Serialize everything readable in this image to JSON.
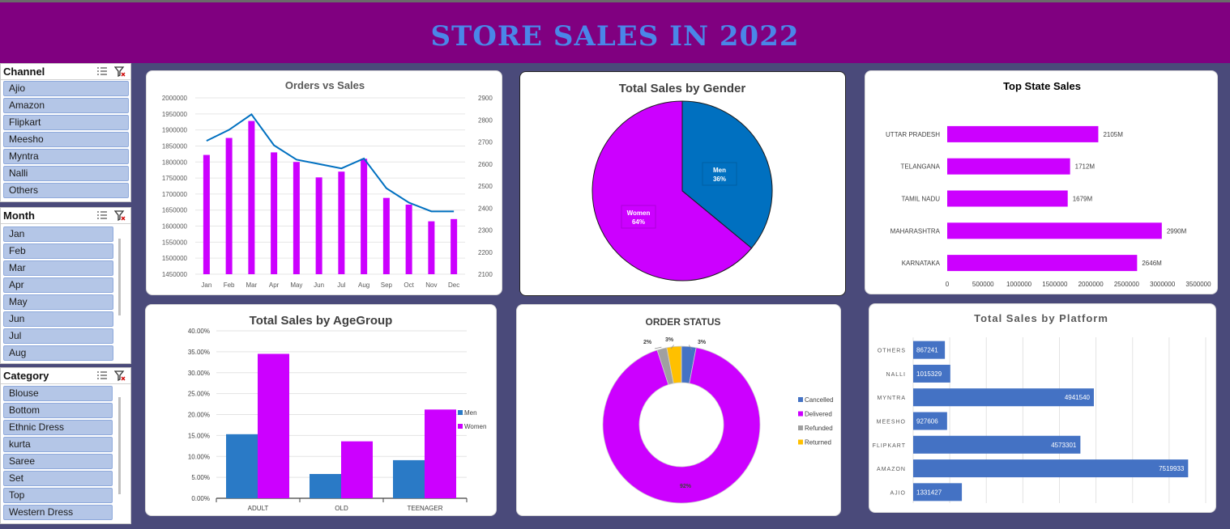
{
  "header": {
    "title": "STORE SALES IN 2022"
  },
  "slicers": {
    "channel": {
      "title": "Channel",
      "items": [
        "Ajio",
        "Amazon",
        "Flipkart",
        "Meesho",
        "Myntra",
        "Nalli",
        "Others"
      ]
    },
    "month": {
      "title": "Month",
      "items": [
        "Jan",
        "Feb",
        "Mar",
        "Apr",
        "May",
        "Jun",
        "Jul",
        "Aug"
      ]
    },
    "category": {
      "title": "Category",
      "items": [
        "Blouse",
        "Bottom",
        "Ethnic Dress",
        "kurta",
        "Saree",
        "Set",
        "Top",
        "Western Dress"
      ]
    }
  },
  "colors": {
    "magenta": "#cc00ff",
    "blue": "#0070c0",
    "bar_blue": "#4472c4",
    "gray": "#a0a0a0",
    "gold": "#ffc000",
    "banner": "#800080",
    "title_blue": "#4a86e8"
  },
  "chart_data": [
    {
      "id": "orders_vs_sales",
      "type": "bar",
      "title": "Orders vs Sales",
      "categories": [
        "Jan",
        "Feb",
        "Mar",
        "Apr",
        "May",
        "Jun",
        "Jul",
        "Aug",
        "Sep",
        "Oct",
        "Nov",
        "Dec"
      ],
      "series": [
        {
          "type": "bar",
          "axis": "left",
          "values": [
            1822000,
            1875000,
            1928000,
            1830000,
            1800000,
            1752000,
            1770000,
            1810000,
            1688000,
            1667000,
            1615000,
            1622000
          ]
        },
        {
          "type": "line",
          "axis": "right",
          "values": [
            2705,
            2755,
            2825,
            2685,
            2620,
            2600,
            2580,
            2625,
            2490,
            2425,
            2385,
            2385
          ]
        }
      ],
      "ylim_left": [
        1450000,
        2000000
      ],
      "yticks_left": [
        "2000000",
        "1950000",
        "1900000",
        "1850000",
        "1800000",
        "1750000",
        "1700000",
        "1650000",
        "1600000",
        "1550000",
        "1500000",
        "1450000"
      ],
      "ylim_right": [
        2100,
        2900
      ],
      "yticks_right": [
        "2900",
        "2800",
        "2700",
        "2600",
        "2500",
        "2400",
        "2300",
        "2200",
        "2100"
      ]
    },
    {
      "id": "sales_by_gender",
      "type": "pie",
      "title": "Total Sales by Gender",
      "slices": [
        {
          "name": "Men",
          "value": 36,
          "label": "36%"
        },
        {
          "name": "Women",
          "value": 64,
          "label": "64%"
        }
      ]
    },
    {
      "id": "top_state_sales",
      "type": "bar",
      "orientation": "horizontal",
      "title": "Top State Sales",
      "categories": [
        "UTTAR PRADESH",
        "TELANGANA",
        "TAMIL NADU",
        "MAHARASHTRA",
        "KARNATAKA"
      ],
      "values": [
        2105000,
        1712000,
        1679000,
        2990000,
        2646000
      ],
      "value_labels": [
        "2105M",
        "1712M",
        "1679M",
        "2990M",
        "2646M"
      ],
      "xlim": [
        0,
        3500000
      ],
      "xticks": [
        "0",
        "500000",
        "1000000",
        "1500000",
        "2000000",
        "2500000",
        "3000000",
        "3500000"
      ]
    },
    {
      "id": "sales_by_agegroup",
      "type": "bar",
      "title": "Total Sales by AgeGroup",
      "categories": [
        "ADULT",
        "OLD",
        "TEENAGER"
      ],
      "series": [
        {
          "name": "Men",
          "values": [
            15.3,
            5.8,
            9.1
          ]
        },
        {
          "name": "Women",
          "values": [
            34.5,
            13.6,
            21.2
          ]
        }
      ],
      "ylim": [
        0,
        40
      ],
      "yticks": [
        "40.00%",
        "35.00%",
        "30.00%",
        "25.00%",
        "20.00%",
        "15.00%",
        "10.00%",
        "5.00%",
        "0.00%"
      ],
      "legend": "right"
    },
    {
      "id": "order_status",
      "type": "pie",
      "variant": "donut",
      "title": "ORDER STATUS",
      "slices": [
        {
          "name": "Cancelled",
          "value": 3,
          "label": "3%"
        },
        {
          "name": "Delivered",
          "value": 92,
          "label": "92%"
        },
        {
          "name": "Refunded",
          "value": 2,
          "label": "2%"
        },
        {
          "name": "Returned",
          "value": 3,
          "label": "3%"
        }
      ],
      "legend": "right"
    },
    {
      "id": "sales_by_platform",
      "type": "bar",
      "orientation": "horizontal",
      "title": "Total Sales by Platform",
      "categories": [
        "OTHERS",
        "NALLI",
        "MYNTRA",
        "MEESHO",
        "FLIPKART",
        "AMAZON",
        "AJIO"
      ],
      "values": [
        867241,
        1015329,
        4941540,
        927606,
        4573301,
        7519933,
        1331427
      ],
      "value_labels": [
        "867241",
        "1015329",
        "4941540",
        "927606",
        "4573301",
        "7519933",
        "1331427"
      ],
      "xlim": [
        0,
        8000000
      ]
    }
  ]
}
